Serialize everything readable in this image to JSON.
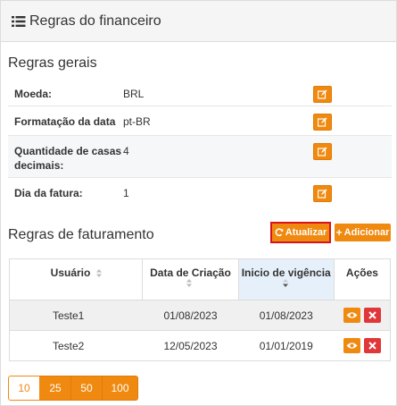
{
  "header": {
    "title": "Regras do financeiro",
    "icon": "list-icon"
  },
  "general": {
    "title": "Regras gerais",
    "rows": [
      {
        "label": "Moeda:",
        "value": "BRL"
      },
      {
        "label": "Formatação da data",
        "value": "pt-BR"
      },
      {
        "label": "Quantidade de casas decimais:",
        "value": "4"
      },
      {
        "label": "Dia da fatura:",
        "value": "1"
      }
    ]
  },
  "billing": {
    "title": "Regras de faturamento",
    "update_label": "Atualizar",
    "add_label": "Adicionar",
    "columns": [
      "Usuário",
      "Data de Criação",
      "Inicio de vigência",
      "Ações"
    ],
    "rows": [
      {
        "user": "Teste1",
        "created": "01/08/2023",
        "start": "01/08/2023"
      },
      {
        "user": "Teste2",
        "created": "12/05/2023",
        "start": "01/01/2019"
      }
    ]
  },
  "pagination": {
    "sizes": [
      "10",
      "25",
      "50",
      "100"
    ],
    "selected": "10"
  },
  "colors": {
    "accent": "#f0890f",
    "danger": "#e0373a",
    "highlight_border": "#d8141a",
    "sorted_column": "#e6f0fb"
  }
}
